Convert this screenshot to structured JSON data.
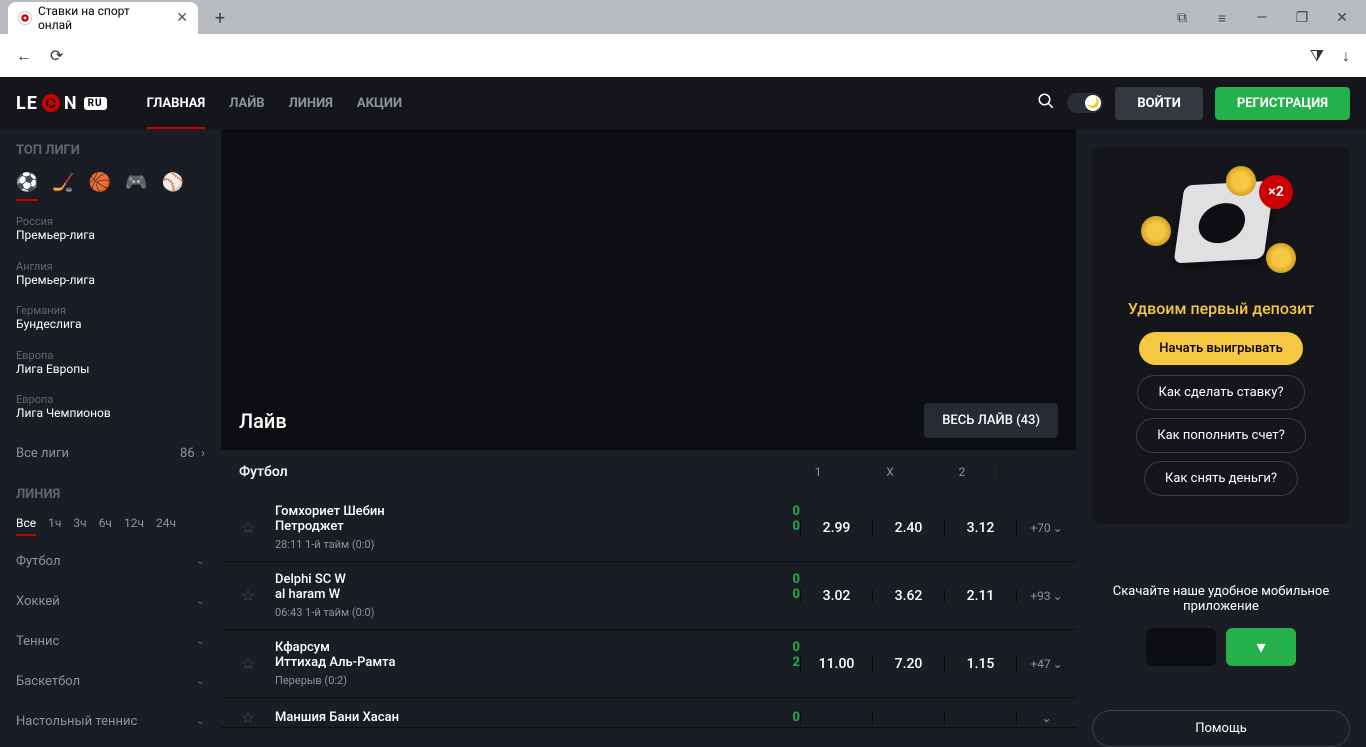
{
  "browser": {
    "tab_title": "Ставки на спорт онлай"
  },
  "logo": {
    "le": "LE",
    "n": "N",
    "ru": "RU"
  },
  "nav": {
    "home": "ГЛАВНАЯ",
    "live": "ЛАЙВ",
    "line": "ЛИНИЯ",
    "promo": "АКЦИИ"
  },
  "header": {
    "login": "ВОЙТИ",
    "register": "РЕГИСТРАЦИЯ"
  },
  "sidebar": {
    "top_heading": "ТОП ЛИГИ",
    "leagues": [
      {
        "country": "Россия",
        "name": "Премьер-лига"
      },
      {
        "country": "Англия",
        "name": "Премьер-лига"
      },
      {
        "country": "Германия",
        "name": "Бундеслига"
      },
      {
        "country": "Европа",
        "name": "Лига Европы"
      },
      {
        "country": "Европа",
        "name": "Лига Чемпионов"
      }
    ],
    "all_leagues": "Все лиги",
    "all_leagues_count": "86",
    "line_heading": "ЛИНИЯ",
    "filters": [
      "Все",
      "1ч",
      "3ч",
      "6ч",
      "12ч",
      "24ч"
    ],
    "sports": [
      "Футбол",
      "Хоккей",
      "Теннис",
      "Баскетбол",
      "Настольный теннис"
    ]
  },
  "main": {
    "live_title": "Лайв",
    "all_live": "ВЕСЬ ЛАЙВ (43)",
    "sport_label": "Футбол",
    "odds_headers": [
      "1",
      "X",
      "2"
    ],
    "matches": [
      {
        "t1": "Гомхориет Шебин",
        "t2": "Петроджет",
        "s1": "0",
        "s2": "0",
        "time": "28:11",
        "stage": "1-й тайм (0:0)",
        "o1": "2.99",
        "ox": "2.40",
        "o2": "3.12",
        "more": "+70"
      },
      {
        "t1": "Delphi SC W",
        "t2": "al haram W",
        "s1": "0",
        "s2": "0",
        "time": "06:43",
        "stage": "1-й тайм (0:0)",
        "o1": "3.02",
        "ox": "3.62",
        "o2": "2.11",
        "more": "+93"
      },
      {
        "t1": "Кфарсум",
        "t2": "Иттихад Аль-Рамта",
        "s1": "0",
        "s2": "2",
        "time": "",
        "stage": "Перерыв (0:2)",
        "o1": "11.00",
        "ox": "7.20",
        "o2": "1.15",
        "more": "+47"
      },
      {
        "t1": "Маншия Бани Хасан",
        "t2": "",
        "s1": "0",
        "s2": "",
        "time": "",
        "stage": "",
        "o1": "",
        "ox": "",
        "o2": "",
        "more": ""
      }
    ]
  },
  "rside": {
    "x2": "×2",
    "promo_title": "Удвоим первый депозит",
    "start": "Начать выигрывать",
    "how_bet": "Как сделать ставку?",
    "how_deposit": "Как пополнить счет?",
    "how_withdraw": "Как снять деньги?",
    "download_text": "Скачайте наше удобное мобильное приложение",
    "help": "Помощь"
  }
}
